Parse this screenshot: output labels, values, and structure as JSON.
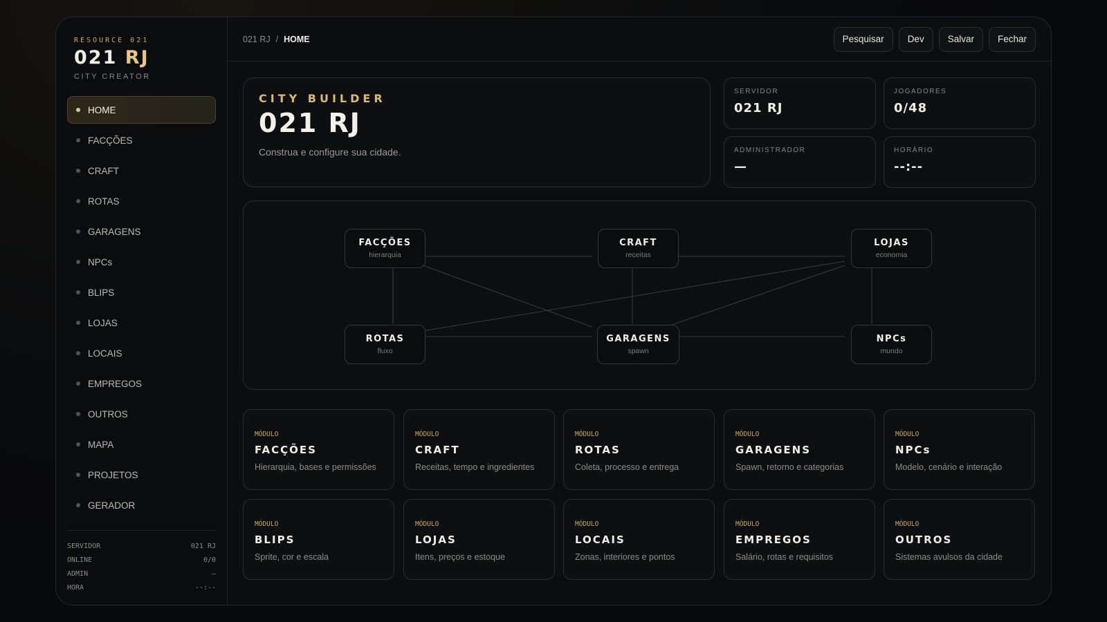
{
  "brand": {
    "kicker": "RESOURCE 021",
    "title_main": "021",
    "title_accent": "RJ",
    "subtitle": "CITY CREATOR"
  },
  "nav": [
    {
      "label": "HOME",
      "active": true
    },
    {
      "label": "FACÇÕES"
    },
    {
      "label": "CRAFT"
    },
    {
      "label": "ROTAS"
    },
    {
      "label": "GARAGENS"
    },
    {
      "label": "NPCs"
    },
    {
      "label": "BLIPS"
    },
    {
      "label": "LOJAS"
    },
    {
      "label": "LOCAIS"
    },
    {
      "label": "EMPREGOS"
    },
    {
      "label": "OUTROS"
    },
    {
      "label": "MAPA"
    },
    {
      "label": "PROJETOS"
    },
    {
      "label": "GERADOR"
    }
  ],
  "side_stats": [
    {
      "label": "SERVIDOR",
      "value": "021 RJ"
    },
    {
      "label": "ONLINE",
      "value": "0/0"
    },
    {
      "label": "ADMIN",
      "value": "—"
    },
    {
      "label": "HORA",
      "value": "--:--"
    }
  ],
  "breadcrumb": {
    "root": "021 RJ",
    "separator": "/",
    "current": "HOME"
  },
  "actions": {
    "search": "Pesquisar",
    "dev": "Dev",
    "save": "Salvar",
    "close": "Fechar"
  },
  "hero": {
    "kicker": "CITY BUILDER",
    "title": "021 RJ",
    "description": "Construa e configure sua cidade."
  },
  "stats": [
    {
      "label": "SERVIDOR",
      "value": "021 RJ"
    },
    {
      "label": "JOGADORES",
      "value": "0/48"
    },
    {
      "label": "ADMINISTRADOR",
      "value": "—"
    },
    {
      "label": "HORÁRIO",
      "value": "--:--"
    }
  ],
  "graph_nodes": [
    {
      "title": "FACÇÕES",
      "sub": "hierarquia"
    },
    {
      "title": "CRAFT",
      "sub": "receitas"
    },
    {
      "title": "LOJAS",
      "sub": "economia"
    },
    {
      "title": "ROTAS",
      "sub": "fluxo"
    },
    {
      "title": "GARAGENS",
      "sub": "spawn"
    },
    {
      "title": "NPCs",
      "sub": "mundo"
    }
  ],
  "modules": [
    {
      "kicker": "MÓDULO",
      "title": "FACÇÕES",
      "desc": "Hierarquia, bases e permissões"
    },
    {
      "kicker": "MÓDULO",
      "title": "CRAFT",
      "desc": "Receitas, tempo e ingredientes"
    },
    {
      "kicker": "MÓDULO",
      "title": "ROTAS",
      "desc": "Coleta, processo e entrega"
    },
    {
      "kicker": "MÓDULO",
      "title": "GARAGENS",
      "desc": "Spawn, retorno e categorias"
    },
    {
      "kicker": "MÓDULO",
      "title": "NPCs",
      "desc": "Modelo, cenário e interação"
    },
    {
      "kicker": "MÓDULO",
      "title": "BLIPS",
      "desc": "Sprite, cor e escala"
    },
    {
      "kicker": "MÓDULO",
      "title": "LOJAS",
      "desc": "Itens, preços e estoque"
    },
    {
      "kicker": "MÓDULO",
      "title": "LOCAIS",
      "desc": "Zonas, interiores e pontos"
    },
    {
      "kicker": "MÓDULO",
      "title": "EMPREGOS",
      "desc": "Salário, rotas e requisitos"
    },
    {
      "kicker": "MÓDULO",
      "title": "OUTROS",
      "desc": "Sistemas avulsos da cidade"
    }
  ],
  "colors": {
    "accent": "#dbbb73",
    "background": "#0c0d0f",
    "border": "#2a2b2f"
  }
}
